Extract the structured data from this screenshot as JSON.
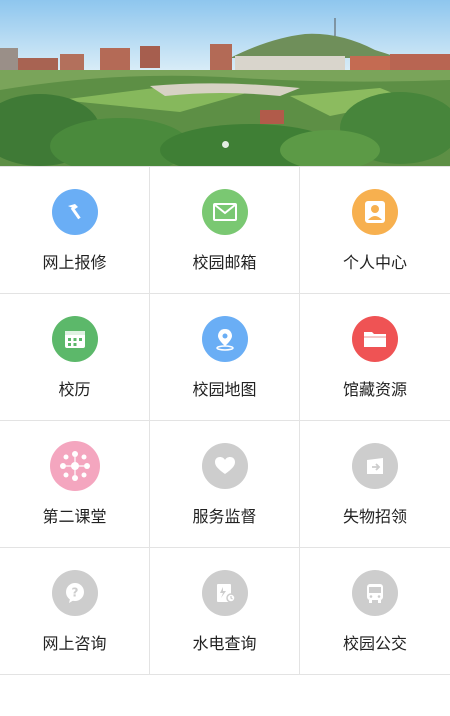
{
  "banner": {
    "dot_count": 1,
    "active_dot": 0
  },
  "menu": [
    {
      "label": "网上报修",
      "icon": "hammer-icon",
      "color": "#6aaef5"
    },
    {
      "label": "校园邮箱",
      "icon": "mail-icon",
      "color": "#7ac872"
    },
    {
      "label": "个人中心",
      "icon": "person-icon",
      "color": "#f7b04f"
    },
    {
      "label": "校历",
      "icon": "calendar-icon",
      "color": "#5cb86a"
    },
    {
      "label": "校园地图",
      "icon": "map-pin-icon",
      "color": "#6aaef5"
    },
    {
      "label": "馆藏资源",
      "icon": "folder-icon",
      "color": "#ef5354"
    },
    {
      "label": "第二课堂",
      "icon": "second-class-icon",
      "color": "#f4a6bf"
    },
    {
      "label": "服务监督",
      "icon": "heart-icon",
      "color": "#cdcdcd"
    },
    {
      "label": "失物招领",
      "icon": "exit-box-icon",
      "color": "#cdcdcd"
    },
    {
      "label": "网上咨询",
      "icon": "question-icon",
      "color": "#cdcdcd"
    },
    {
      "label": "水电查询",
      "icon": "meter-icon",
      "color": "#cdcdcd"
    },
    {
      "label": "校园公交",
      "icon": "bus-icon",
      "color": "#cdcdcd"
    }
  ]
}
